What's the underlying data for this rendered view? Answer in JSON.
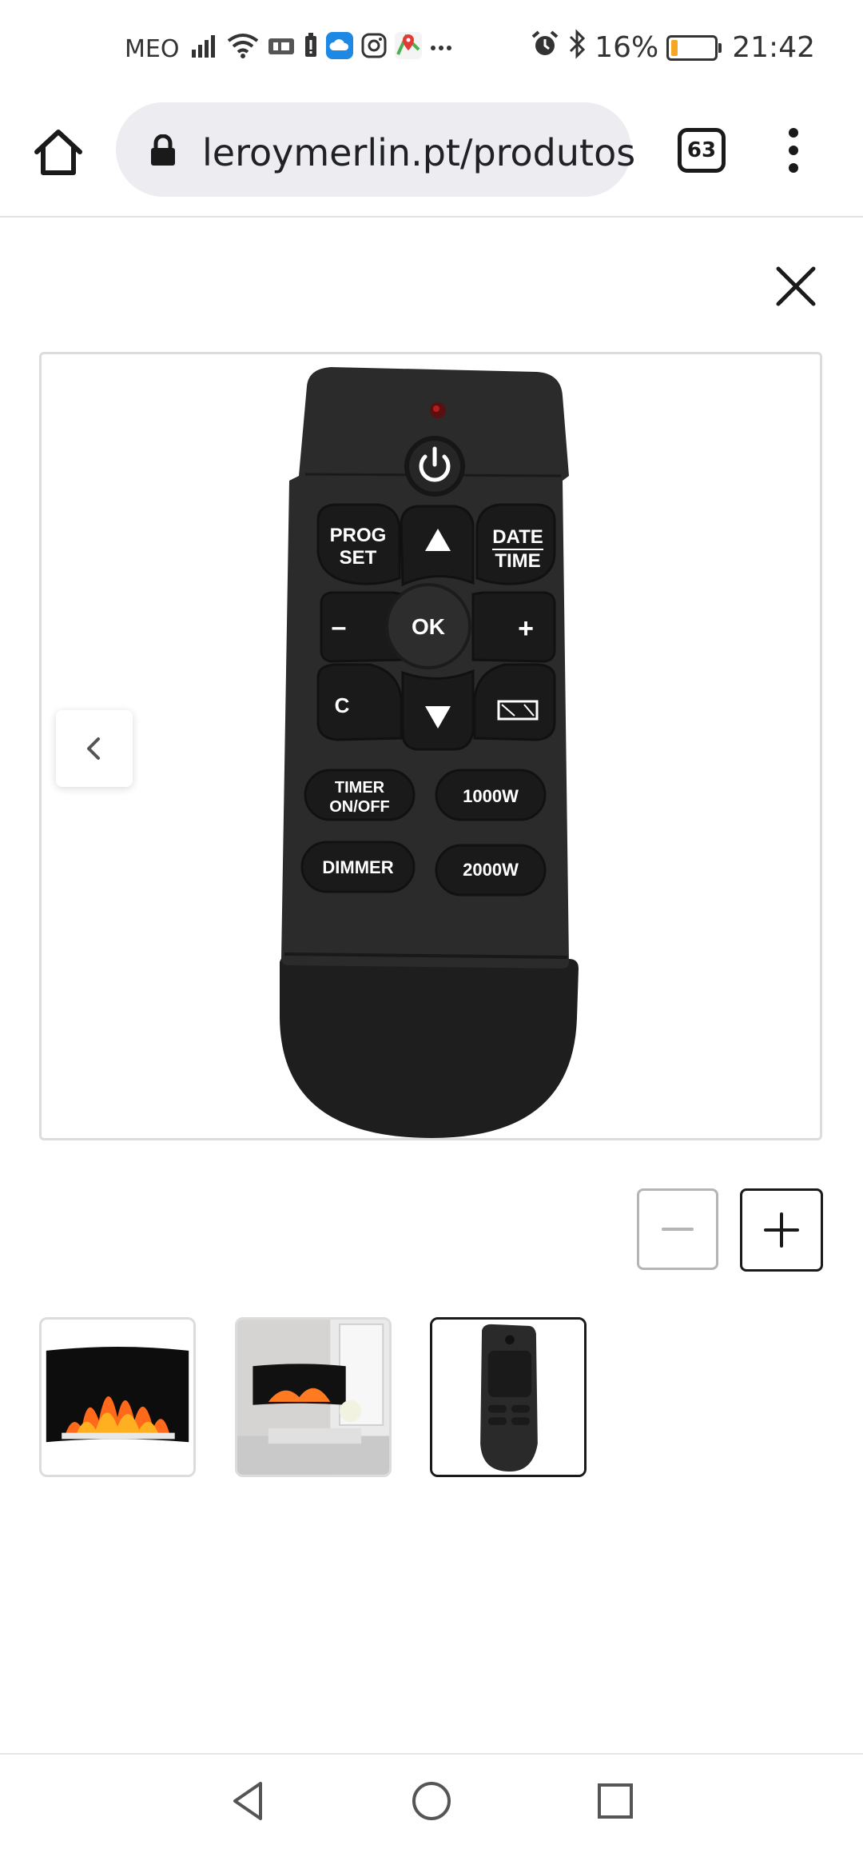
{
  "status_bar": {
    "carrier": "MEO",
    "battery_percent": "16%",
    "battery_level": 0.16,
    "time": "21:42",
    "icons": [
      "signal-icon",
      "wifi-icon",
      "data-saver-icon",
      "battery-saver-icon",
      "cloud-icon",
      "instagram-icon",
      "maps-icon",
      "more-notifications-icon",
      "alarm-icon",
      "bluetooth-icon",
      "battery-icon"
    ]
  },
  "browser": {
    "url": "leroymerlin.pt/produtos",
    "tab_count": "63"
  },
  "gallery": {
    "main_image": {
      "subject": "remote-control",
      "buttons": {
        "prog_line1": "PROG",
        "prog_line2": "SET",
        "date_line1": "DATE",
        "date_line2": "TIME",
        "ok": "OK",
        "minus": "–",
        "plus": "+",
        "c": "C",
        "timer_line1": "TIMER",
        "timer_line2": "ON/OFF",
        "w1000": "1000W",
        "dimmer": "DIMMER",
        "w2000": "2000W"
      }
    },
    "thumbnails": [
      {
        "subject": "fireplace-front",
        "active": false
      },
      {
        "subject": "fireplace-room",
        "active": false
      },
      {
        "subject": "remote-control",
        "active": true
      }
    ]
  },
  "colors": {
    "accent_border": "#1a1a1a",
    "battery_fill": "#f5a623"
  }
}
